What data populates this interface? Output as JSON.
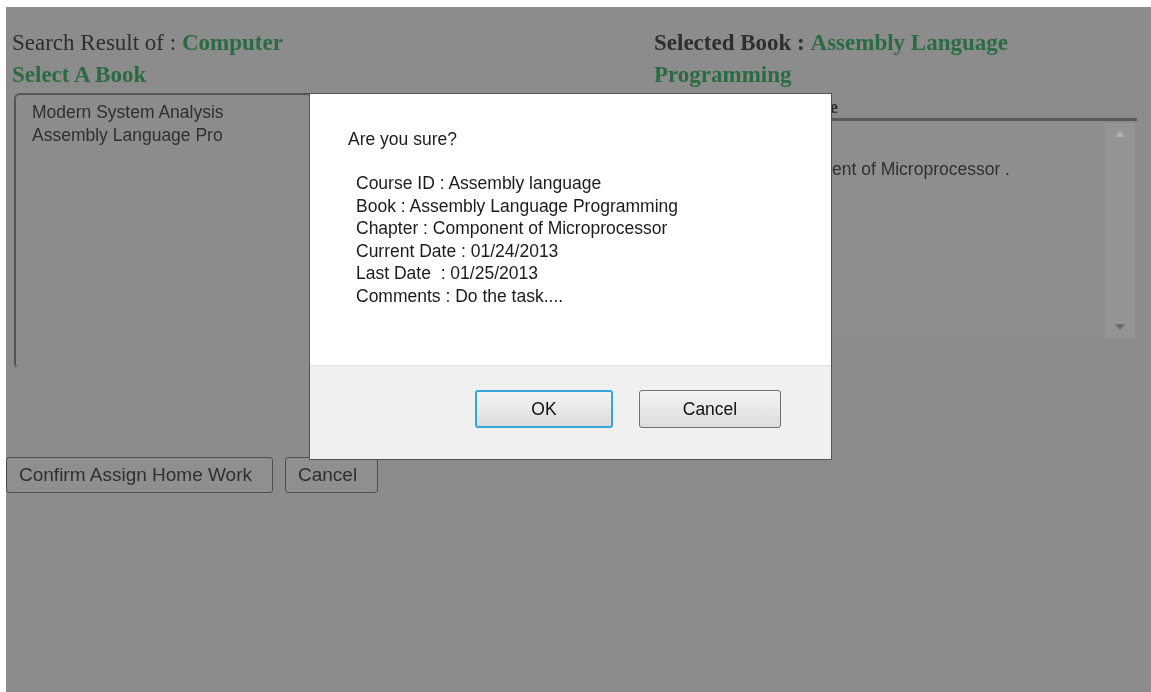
{
  "search_result": {
    "label": "Search Result of :",
    "query": "Computer"
  },
  "book_list": {
    "title": "Select A Book",
    "items": [
      "Modern System Analysis",
      "Assembly Language Pro"
    ]
  },
  "selected_book": {
    "label": "Selected Book :",
    "value": "Assembly Language Programming"
  },
  "chapter_list": {
    "header": "e",
    "text": "ent of Microprocessor ."
  },
  "actions": [
    "Confirm Assign Home Work",
    "Cancel"
  ],
  "dialog": {
    "question": "Are you sure?",
    "details": [
      "Course ID : Assembly language",
      "Book : Assembly Language Programming",
      "Chapter : Component of Microprocessor",
      "Current Date : 01/24/2013",
      "Last Date  : 01/25/2013",
      "Comments : Do the task...."
    ],
    "buttons": [
      {
        "label": "OK",
        "focused": true
      },
      {
        "label": "Cancel",
        "focused": false
      }
    ]
  }
}
